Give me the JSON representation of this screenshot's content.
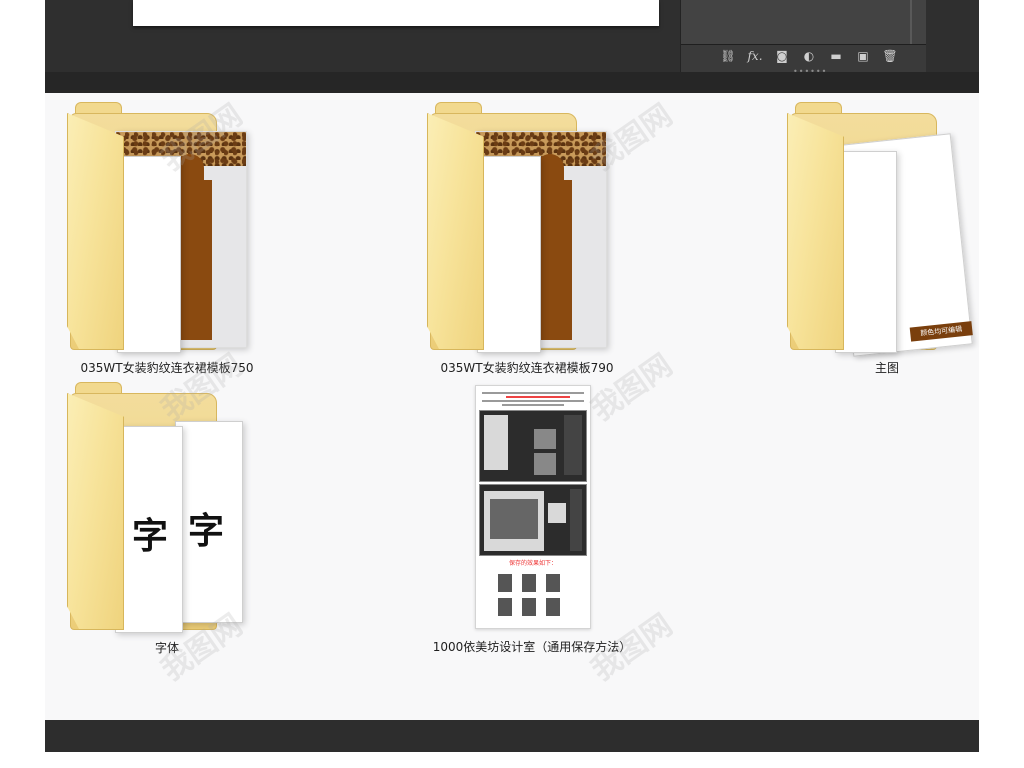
{
  "toolbar": {
    "icons": [
      "link-icon",
      "fx-icon",
      "mask-icon",
      "adjustment-icon",
      "folder-icon",
      "new-layer-icon",
      "trash-icon"
    ],
    "fx_label": "fx."
  },
  "files": [
    {
      "name": "035WT女装豹纹连衣裙模板750",
      "type": "folder"
    },
    {
      "name": "035WT女装豹纹连衣裙模板790",
      "type": "folder"
    },
    {
      "name": "主图",
      "type": "folder",
      "strip_text": "颜色均可编辑"
    },
    {
      "name": "字体",
      "type": "folder",
      "glyphs": [
        "字",
        "字"
      ]
    },
    {
      "name": "1000依美坊设计室（通用保存方法）",
      "type": "image",
      "caption": "保存的效果如下："
    }
  ],
  "watermark": "我图网",
  "colors": {
    "panel_dark": "#2f2f2f",
    "explorer_bg": "#f8f8f9",
    "folder": "#f3dd9c",
    "brand": "#7a3f0d"
  }
}
